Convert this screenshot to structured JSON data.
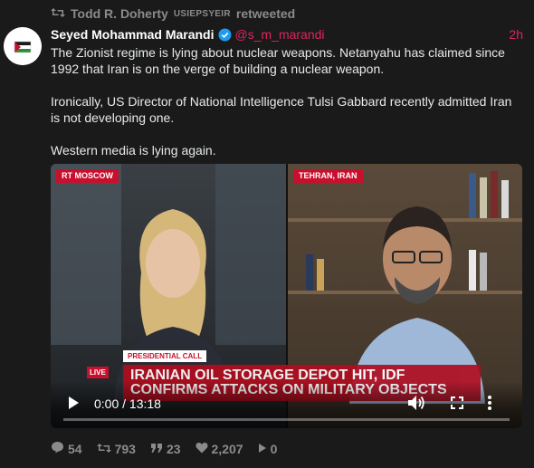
{
  "retweet": {
    "icon": "retweet-icon",
    "name": "Todd R. Doherty",
    "tag": "USIEPSYEIR",
    "suffix": "retweeted"
  },
  "author": {
    "name": "Seyed Mohammad Marandi",
    "handle": "@s_m_marandi",
    "time": "2h",
    "verified": true,
    "accent": "#e0245e"
  },
  "tweet": {
    "paragraphs": [
      "The Zionist regime is lying about nuclear weapons. Netanyahu has claimed since 1992 that Iran is on the verge of building a nuclear weapon.",
      "Ironically, US Director of National Intelligence Tulsi Gabbard recently admitted Iran is not developing one.",
      "Western media is lying again."
    ]
  },
  "video": {
    "left_tag": "RT MOSCOW",
    "right_tag": "TEHRAN, IRAN",
    "lower_third_label": "PRESIDENTIAL CALL",
    "live": "LIVE",
    "headline": "IRANIAN OIL STORAGE DEPOT HIT, IDF CONFIRMS ATTACKS ON MILITARY OBJECTS",
    "time_display": "0:00 / 13:18"
  },
  "actions": {
    "replies": "54",
    "retweets": "793",
    "quotes": "23",
    "likes": "2,207",
    "shares": "0"
  }
}
